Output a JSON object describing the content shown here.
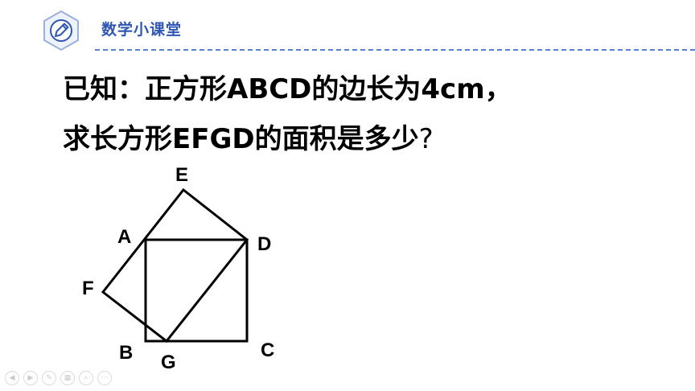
{
  "header": {
    "title": "数学小课堂",
    "logo_icon": "pencil-icon",
    "accent_color": "#2f56b0"
  },
  "problem": {
    "line1": "已知：正方形ABCD的边长为4cm，",
    "line2_text": "求长方形EFGD的面积是多少",
    "line2_mark": "?"
  },
  "figure": {
    "labels": {
      "E": "E",
      "A": "A",
      "D": "D",
      "F": "F",
      "B": "B",
      "G": "G",
      "C": "C"
    }
  },
  "toolbar": {
    "buttons": [
      {
        "icon": "prev-icon"
      },
      {
        "icon": "next-icon"
      },
      {
        "icon": "pen-icon"
      },
      {
        "icon": "slides-icon"
      },
      {
        "icon": "zoom-icon"
      },
      {
        "icon": "more-icon"
      }
    ]
  }
}
